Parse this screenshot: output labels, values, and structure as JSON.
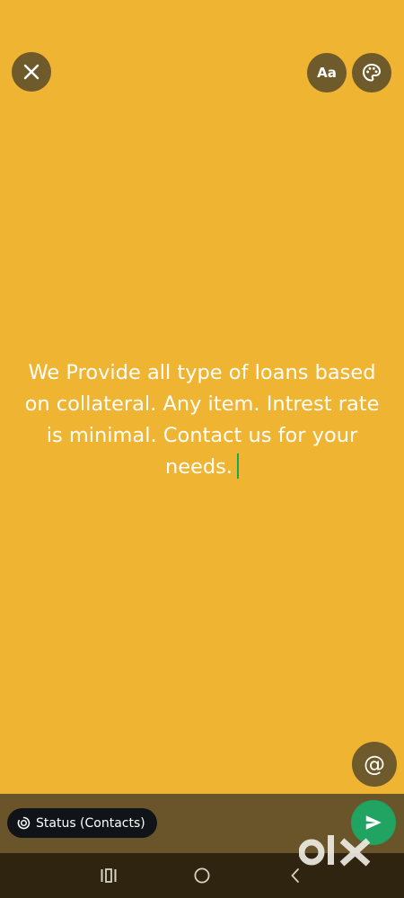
{
  "header": {
    "close_icon": "close-icon",
    "font_label": "Aa",
    "palette_icon": "palette-icon"
  },
  "status": {
    "text": "We Provide all type of loans based on collateral. Any item. Intrest rate is minimal. Contact us for your needs.",
    "background_color": "#EFB431",
    "caret_color": "#1BA75A"
  },
  "mention": {
    "label": "@"
  },
  "footer": {
    "audience_label": "Status (Contacts)",
    "audience_icon": "status-ring-icon",
    "send_icon": "send-icon",
    "send_color": "#21A362"
  },
  "navigation": {
    "recents_icon": "recents-icon",
    "home_icon": "home-icon",
    "back_icon": "back-icon"
  },
  "watermark": {
    "text": "OLX"
  }
}
